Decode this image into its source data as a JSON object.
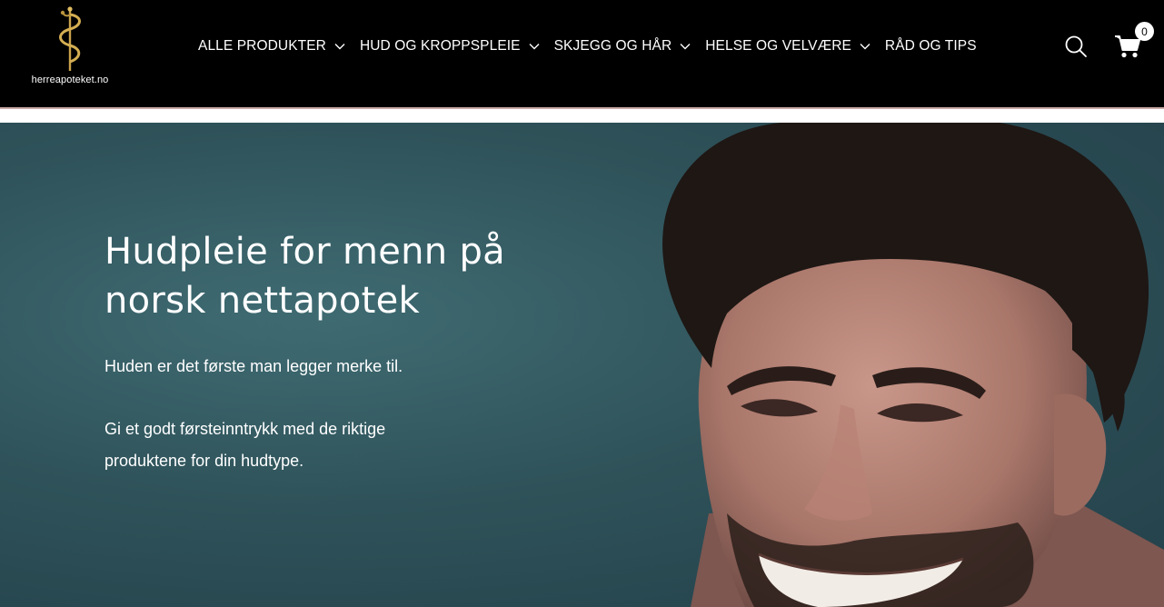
{
  "brand": {
    "logo_text": "herreapoteket.no",
    "logo_icon": "caduceus-icon"
  },
  "nav": {
    "items": [
      {
        "label": "ALLE PRODUKTER",
        "has_dropdown": true
      },
      {
        "label": "HUD OG KROPPSPLEIE",
        "has_dropdown": true
      },
      {
        "label": "SKJEGG OG HÅR",
        "has_dropdown": true
      },
      {
        "label": "HELSE OG VELVÆRE",
        "has_dropdown": true
      },
      {
        "label": "RÅD OG TIPS",
        "has_dropdown": false
      }
    ]
  },
  "header_actions": {
    "search_icon": "search-icon",
    "cart_icon": "cart-icon",
    "cart_count": "0"
  },
  "hero": {
    "title": "Hudpleie for menn på norsk nettapotek",
    "paragraph_1": "Huden er det første man legger merke til.",
    "paragraph_2": "Gi et godt førsteinntrykk med de riktige produktene for din hudtype."
  },
  "colors": {
    "header_bg": "#000000",
    "logo_gold": "#c9a24a",
    "hero_bg": "#2f5259",
    "text_light": "#ffffff"
  }
}
